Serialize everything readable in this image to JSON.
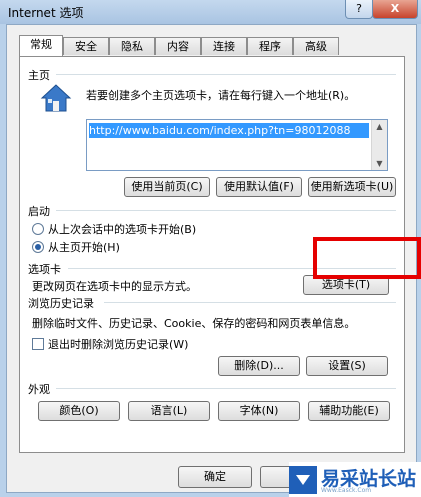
{
  "window": {
    "title": "Internet 选项",
    "help_label": "?",
    "close_label": "X"
  },
  "tabs": [
    "常规",
    "安全",
    "隐私",
    "内容",
    "连接",
    "程序",
    "高级"
  ],
  "home": {
    "label": "主页",
    "instruction": "若要创建多个主页选项卡，请在每行键入一个地址(R)。",
    "url": "http://www.baidu.com/index.php?tn=98012088",
    "use_current": "使用当前页(C)",
    "use_default": "使用默认值(F)",
    "use_new_tab": "使用新选项卡(U)"
  },
  "startup": {
    "label": "启动",
    "option_last_session": "从上次会话中的选项卡开始(B)",
    "option_home": "从主页开始(H)",
    "selected": "option_home"
  },
  "tabs_group": {
    "label": "选项卡",
    "description": "更改网页在选项卡中的显示方式。",
    "button": "选项卡(T)"
  },
  "history": {
    "label": "浏览历史记录",
    "description": "删除临时文件、历史记录、Cookie、保存的密码和网页表单信息。",
    "delete_on_exit": "退出时删除浏览历史记录(W)",
    "delete_on_exit_checked": false,
    "delete_button": "删除(D)...",
    "settings_button": "设置(S)"
  },
  "appearance": {
    "label": "外观",
    "colors": "颜色(O)",
    "languages": "语言(L)",
    "fonts": "字体(N)",
    "accessibility": "辅助功能(E)"
  },
  "footer": {
    "ok": "确定"
  },
  "watermark": {
    "name": "易采站长站",
    "sub": "Www.Easck.Com"
  },
  "colors": {
    "highlight": "#e50000",
    "selection": "#3399ff"
  }
}
